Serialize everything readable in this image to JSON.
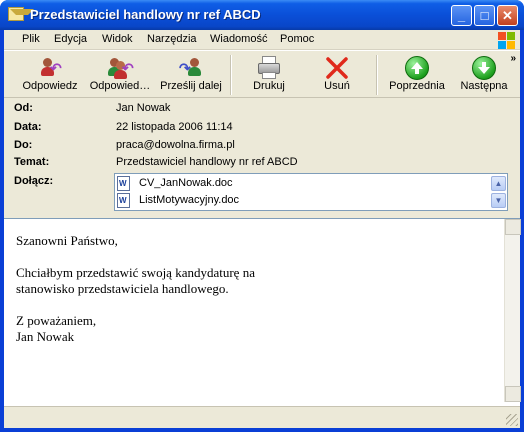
{
  "window": {
    "title": "Przedstawiciel handlowy nr ref ABCD",
    "minimize": "_",
    "maximize": "□",
    "close": "✕"
  },
  "menu": {
    "items": [
      "Plik",
      "Edycja",
      "Widok",
      "Narzędzia",
      "Wiadomość",
      "Pomoc"
    ]
  },
  "toolbar": {
    "reply": "Odpowiedz",
    "reply_all": "Odpowied…",
    "forward": "Prześlij dalej",
    "print": "Drukuj",
    "delete": "Usuń",
    "previous": "Poprzednia",
    "next": "Następna",
    "more": "»"
  },
  "header": {
    "from_label": "Od:",
    "from_value": "Jan Nowak",
    "date_label": "Data:",
    "date_value": "22 listopada 2006 11:14",
    "to_label": "Do:",
    "to_value": "praca@dowolna.firma.pl",
    "subject_label": "Temat:",
    "subject_value": "Przedstawiciel handlowy nr ref ABCD",
    "attach_label": "Dołącz:",
    "attachments": [
      "CV_JanNowak.doc",
      "ListMotywacyjny.doc"
    ]
  },
  "message": {
    "body": "Szanowni Państwo,\n\nChciałbym przedstawić swoją kandydaturę na\nstanowisko przedstawiciela handlowego.\n\nZ poważaniem,\nJan Nowak"
  },
  "colors": {
    "titlebar": "#0a4fd8",
    "face": "#ece9d8",
    "accent_green": "#1fa11f",
    "delete_red": "#e0291b"
  }
}
